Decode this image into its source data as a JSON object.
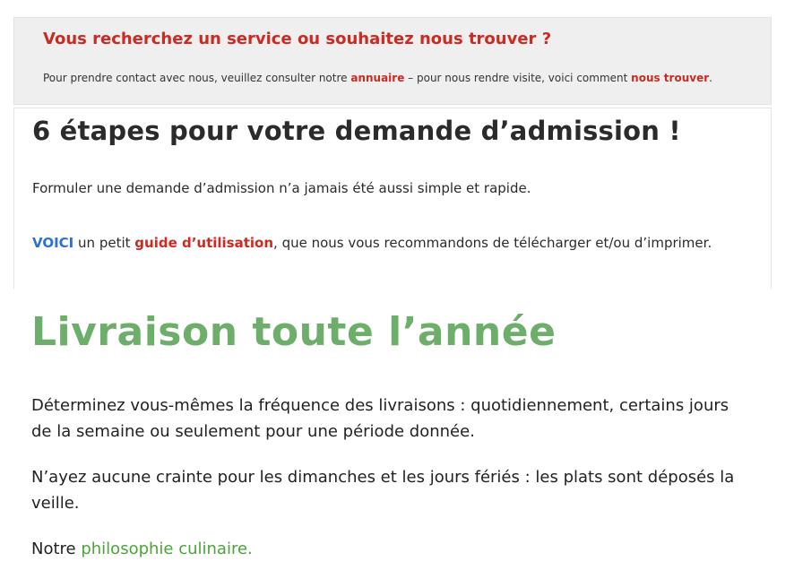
{
  "contact": {
    "title": "Vous recherchez un service ou souhaitez nous trouver ?",
    "text_before": "Pour prendre contact avec nous, veuillez consulter notre ",
    "annuaire_link": "annuaire",
    "text_middle": " – pour nous rendre visite, voici comment ",
    "trouver_link": "nous trouver",
    "text_end": "."
  },
  "admission": {
    "title": "6 étapes pour votre demande d’admission !",
    "intro": "Formuler une demande d’admission n’a jamais été aussi simple et rapide.",
    "voici_link": "VOICI",
    "guide_before": " un petit ",
    "guide_link": "guide d’utilisation",
    "guide_after": ", que nous vous recommandons de télécharger et/ou d’imprimer."
  },
  "delivery": {
    "title": "Livraison toute l’année",
    "paragraph_1": "Déterminez vous-mêmes la fréquence des livraisons : quotidiennement, certains jours de la semaine ou seulement pour une période donnée.",
    "paragraph_2": "N’ayez aucune crainte pour les dimanches et les jours fériés : les plats sont déposés la veille.",
    "notre_label": "Notre ",
    "philosophy_link": "philosophie culinaire."
  },
  "colors": {
    "red": "#cc2a22",
    "blue": "#2f6fd6",
    "green_title": "#6cae6a",
    "green_link": "#4ca33b",
    "contact_background": "#efefef"
  }
}
